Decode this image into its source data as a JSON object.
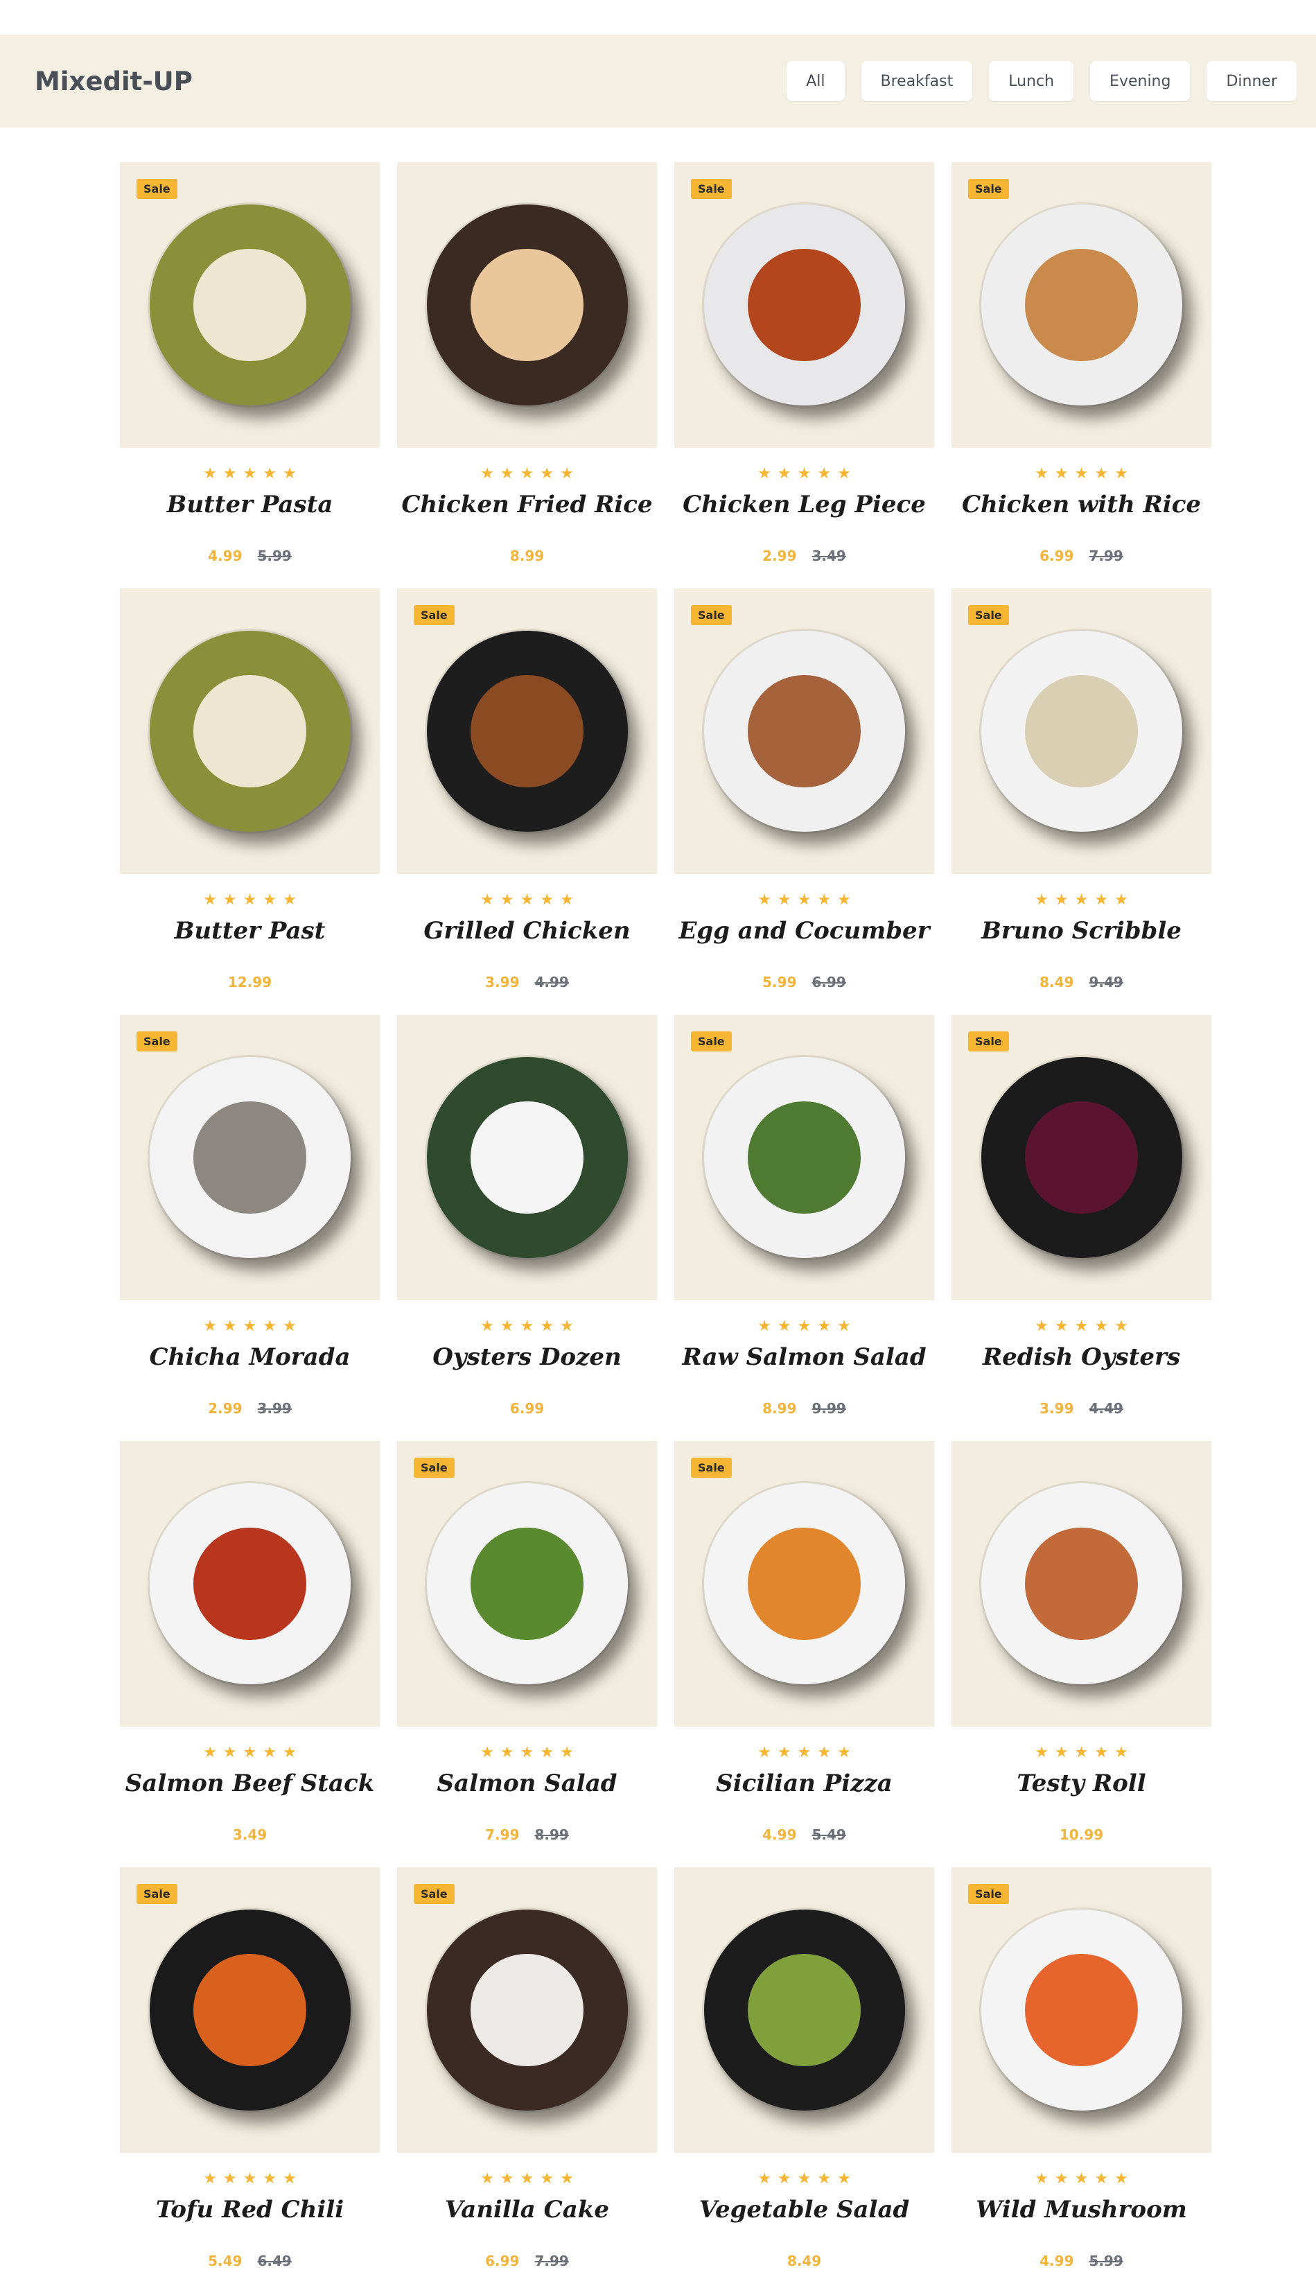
{
  "brand": "Mixedit-UP",
  "filters": [
    {
      "label": "All"
    },
    {
      "label": "Breakfast"
    },
    {
      "label": "Lunch"
    },
    {
      "label": "Evening"
    },
    {
      "label": "Dinner"
    }
  ],
  "sale_label": "Sale",
  "stars": "★★★★★",
  "colors": {
    "accent": "#f7b534",
    "card_bg": "#f3eddf",
    "nav_bg": "#f3efe3"
  },
  "products": [
    {
      "name": "Butter Pasta",
      "price": "4.99",
      "old_price": "5.99",
      "sale": true,
      "plate": "#8a8f3a",
      "food": "#efe6d2"
    },
    {
      "name": "Chicken Fried Rice",
      "price": "8.99",
      "old_price": "",
      "sale": false,
      "plate": "#3a2a22",
      "food": "#e9c79a"
    },
    {
      "name": "Chicken Leg Piece",
      "price": "2.99",
      "old_price": "3.49",
      "sale": true,
      "plate": "#e8e8ea",
      "food": "#b4461d"
    },
    {
      "name": "Chicken with Rice",
      "price": "6.99",
      "old_price": "7.99",
      "sale": true,
      "plate": "#eeeeee",
      "food": "#c98a4b"
    },
    {
      "name": "Butter Past",
      "price": "12.99",
      "old_price": "",
      "sale": false,
      "plate": "#8a8f3a",
      "food": "#efe6d2"
    },
    {
      "name": "Grilled Chicken",
      "price": "3.99",
      "old_price": "4.99",
      "sale": true,
      "plate": "#1d1d1d",
      "food": "#8a4a22"
    },
    {
      "name": "Egg and Cocumber",
      "price": "5.99",
      "old_price": "6.99",
      "sale": true,
      "plate": "#f0f0f0",
      "food": "#a5623b"
    },
    {
      "name": "Bruno Scribble",
      "price": "8.49",
      "old_price": "9.49",
      "sale": true,
      "plate": "#f2f2f2",
      "food": "#d9cfb2"
    },
    {
      "name": "Chicha Morada",
      "price": "2.99",
      "old_price": "3.99",
      "sale": true,
      "plate": "#f3f3f3",
      "food": "#8c8780"
    },
    {
      "name": "Oysters Dozen",
      "price": "6.99",
      "old_price": "",
      "sale": false,
      "plate": "#2f4a2c",
      "food": "#f5f5f5"
    },
    {
      "name": "Raw Salmon Salad",
      "price": "8.99",
      "old_price": "9.99",
      "sale": true,
      "plate": "#f2f2f2",
      "food": "#4f7a31"
    },
    {
      "name": "Redish Oysters",
      "price": "3.99",
      "old_price": "4.49",
      "sale": true,
      "plate": "#1b1b1b",
      "food": "#5a1430"
    },
    {
      "name": "Salmon Beef Stack",
      "price": "3.49",
      "old_price": "",
      "sale": false,
      "plate": "#f4f4f4",
      "food": "#b8361e"
    },
    {
      "name": "Salmon Salad",
      "price": "7.99",
      "old_price": "8.99",
      "sale": true,
      "plate": "#f4f4f4",
      "food": "#5a8a2f"
    },
    {
      "name": "Sicilian Pizza",
      "price": "4.99",
      "old_price": "5.49",
      "sale": true,
      "plate": "#f4f4f4",
      "food": "#e2862e"
    },
    {
      "name": "Testy Roll",
      "price": "10.99",
      "old_price": "",
      "sale": false,
      "plate": "#f4f4f4",
      "food": "#c26a3a"
    },
    {
      "name": "Tofu Red Chili",
      "price": "5.49",
      "old_price": "6.49",
      "sale": true,
      "plate": "#1a1a1a",
      "food": "#d8611d"
    },
    {
      "name": "Vanilla Cake",
      "price": "6.99",
      "old_price": "7.99",
      "sale": true,
      "plate": "#3b2a24",
      "food": "#ece9e6"
    },
    {
      "name": "Vegetable Salad",
      "price": "8.49",
      "old_price": "",
      "sale": false,
      "plate": "#1c1c1c",
      "food": "#7fa03a"
    },
    {
      "name": "Wild Mushroom",
      "price": "4.99",
      "old_price": "5.99",
      "sale": true,
      "plate": "#f4f4f4",
      "food": "#e7652d"
    }
  ]
}
